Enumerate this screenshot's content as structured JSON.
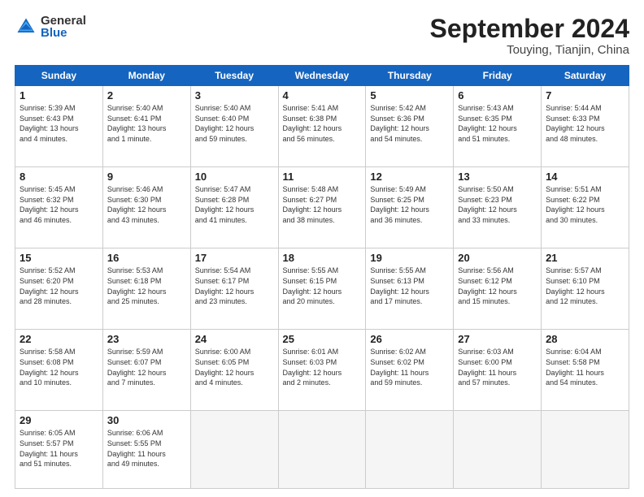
{
  "header": {
    "logo_general": "General",
    "logo_blue": "Blue",
    "month_title": "September 2024",
    "location": "Touying, Tianjin, China"
  },
  "weekdays": [
    "Sunday",
    "Monday",
    "Tuesday",
    "Wednesday",
    "Thursday",
    "Friday",
    "Saturday"
  ],
  "weeks": [
    [
      {
        "day": "1",
        "info": "Sunrise: 5:39 AM\nSunset: 6:43 PM\nDaylight: 13 hours\nand 4 minutes."
      },
      {
        "day": "2",
        "info": "Sunrise: 5:40 AM\nSunset: 6:41 PM\nDaylight: 13 hours\nand 1 minute."
      },
      {
        "day": "3",
        "info": "Sunrise: 5:40 AM\nSunset: 6:40 PM\nDaylight: 12 hours\nand 59 minutes."
      },
      {
        "day": "4",
        "info": "Sunrise: 5:41 AM\nSunset: 6:38 PM\nDaylight: 12 hours\nand 56 minutes."
      },
      {
        "day": "5",
        "info": "Sunrise: 5:42 AM\nSunset: 6:36 PM\nDaylight: 12 hours\nand 54 minutes."
      },
      {
        "day": "6",
        "info": "Sunrise: 5:43 AM\nSunset: 6:35 PM\nDaylight: 12 hours\nand 51 minutes."
      },
      {
        "day": "7",
        "info": "Sunrise: 5:44 AM\nSunset: 6:33 PM\nDaylight: 12 hours\nand 48 minutes."
      }
    ],
    [
      {
        "day": "8",
        "info": "Sunrise: 5:45 AM\nSunset: 6:32 PM\nDaylight: 12 hours\nand 46 minutes."
      },
      {
        "day": "9",
        "info": "Sunrise: 5:46 AM\nSunset: 6:30 PM\nDaylight: 12 hours\nand 43 minutes."
      },
      {
        "day": "10",
        "info": "Sunrise: 5:47 AM\nSunset: 6:28 PM\nDaylight: 12 hours\nand 41 minutes."
      },
      {
        "day": "11",
        "info": "Sunrise: 5:48 AM\nSunset: 6:27 PM\nDaylight: 12 hours\nand 38 minutes."
      },
      {
        "day": "12",
        "info": "Sunrise: 5:49 AM\nSunset: 6:25 PM\nDaylight: 12 hours\nand 36 minutes."
      },
      {
        "day": "13",
        "info": "Sunrise: 5:50 AM\nSunset: 6:23 PM\nDaylight: 12 hours\nand 33 minutes."
      },
      {
        "day": "14",
        "info": "Sunrise: 5:51 AM\nSunset: 6:22 PM\nDaylight: 12 hours\nand 30 minutes."
      }
    ],
    [
      {
        "day": "15",
        "info": "Sunrise: 5:52 AM\nSunset: 6:20 PM\nDaylight: 12 hours\nand 28 minutes."
      },
      {
        "day": "16",
        "info": "Sunrise: 5:53 AM\nSunset: 6:18 PM\nDaylight: 12 hours\nand 25 minutes."
      },
      {
        "day": "17",
        "info": "Sunrise: 5:54 AM\nSunset: 6:17 PM\nDaylight: 12 hours\nand 23 minutes."
      },
      {
        "day": "18",
        "info": "Sunrise: 5:55 AM\nSunset: 6:15 PM\nDaylight: 12 hours\nand 20 minutes."
      },
      {
        "day": "19",
        "info": "Sunrise: 5:55 AM\nSunset: 6:13 PM\nDaylight: 12 hours\nand 17 minutes."
      },
      {
        "day": "20",
        "info": "Sunrise: 5:56 AM\nSunset: 6:12 PM\nDaylight: 12 hours\nand 15 minutes."
      },
      {
        "day": "21",
        "info": "Sunrise: 5:57 AM\nSunset: 6:10 PM\nDaylight: 12 hours\nand 12 minutes."
      }
    ],
    [
      {
        "day": "22",
        "info": "Sunrise: 5:58 AM\nSunset: 6:08 PM\nDaylight: 12 hours\nand 10 minutes."
      },
      {
        "day": "23",
        "info": "Sunrise: 5:59 AM\nSunset: 6:07 PM\nDaylight: 12 hours\nand 7 minutes."
      },
      {
        "day": "24",
        "info": "Sunrise: 6:00 AM\nSunset: 6:05 PM\nDaylight: 12 hours\nand 4 minutes."
      },
      {
        "day": "25",
        "info": "Sunrise: 6:01 AM\nSunset: 6:03 PM\nDaylight: 12 hours\nand 2 minutes."
      },
      {
        "day": "26",
        "info": "Sunrise: 6:02 AM\nSunset: 6:02 PM\nDaylight: 11 hours\nand 59 minutes."
      },
      {
        "day": "27",
        "info": "Sunrise: 6:03 AM\nSunset: 6:00 PM\nDaylight: 11 hours\nand 57 minutes."
      },
      {
        "day": "28",
        "info": "Sunrise: 6:04 AM\nSunset: 5:58 PM\nDaylight: 11 hours\nand 54 minutes."
      }
    ],
    [
      {
        "day": "29",
        "info": "Sunrise: 6:05 AM\nSunset: 5:57 PM\nDaylight: 11 hours\nand 51 minutes."
      },
      {
        "day": "30",
        "info": "Sunrise: 6:06 AM\nSunset: 5:55 PM\nDaylight: 11 hours\nand 49 minutes."
      },
      {
        "day": "",
        "info": ""
      },
      {
        "day": "",
        "info": ""
      },
      {
        "day": "",
        "info": ""
      },
      {
        "day": "",
        "info": ""
      },
      {
        "day": "",
        "info": ""
      }
    ]
  ]
}
